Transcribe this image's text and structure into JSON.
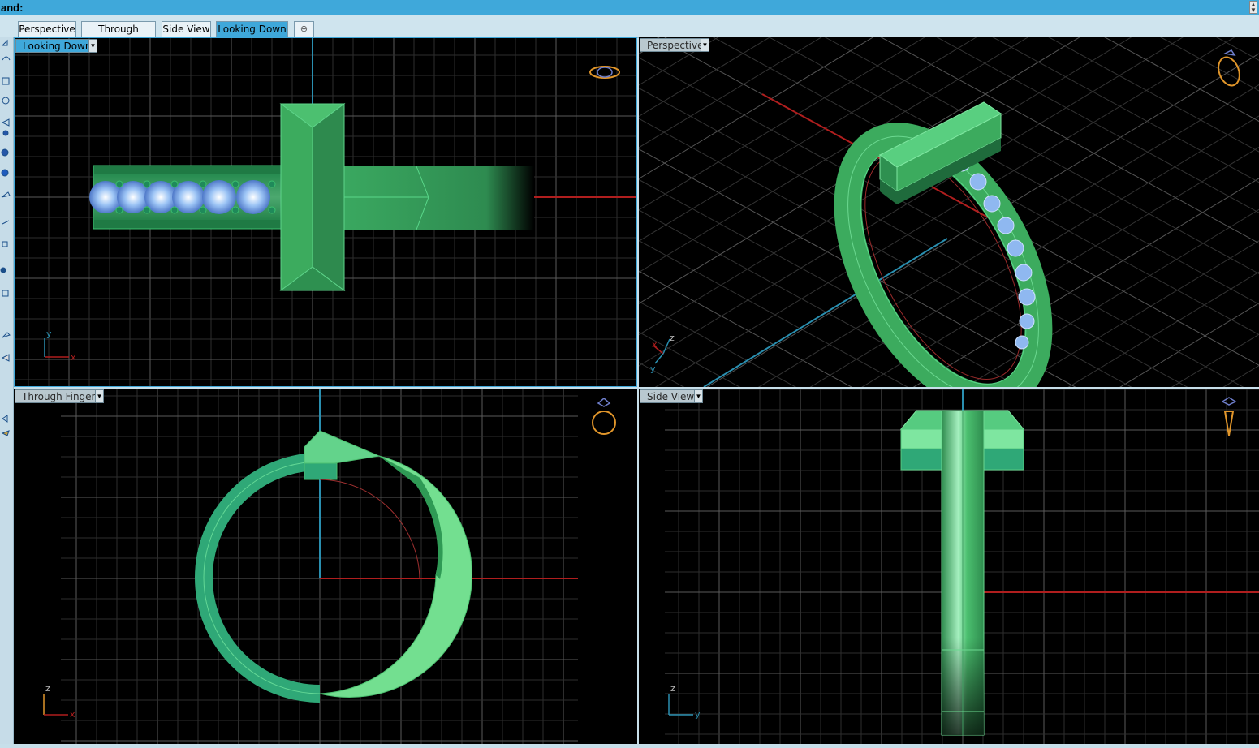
{
  "command_bar": {
    "prompt": "and:"
  },
  "tabs": [
    {
      "label": "Perspective",
      "active": false
    },
    {
      "label": "Through Finger",
      "active": false
    },
    {
      "label": "Side View",
      "active": false
    },
    {
      "label": "Looking Down",
      "active": true
    }
  ],
  "add_tab_icon": "plus-icon",
  "viewports": {
    "top_left": {
      "label": "Looking Down",
      "active": true,
      "axes": [
        "y",
        "x"
      ]
    },
    "top_right": {
      "label": "Perspective",
      "active": false,
      "axes": [
        "z",
        "x",
        "y"
      ]
    },
    "bottom_left": {
      "label": "Through Finger",
      "active": false,
      "axes": [
        "z",
        "x"
      ]
    },
    "bottom_right": {
      "label": "Side View",
      "active": false,
      "axes": [
        "z",
        "y"
      ]
    }
  },
  "colors": {
    "viewport_bg": "#000000",
    "grid": "#3c3c3c",
    "x_axis": "#b01e1e",
    "y_axis": "#2a8fb0",
    "model_green": "#3cb06a",
    "gem_blue": "#8fb8f0",
    "active_tab": "#3fa8da"
  }
}
